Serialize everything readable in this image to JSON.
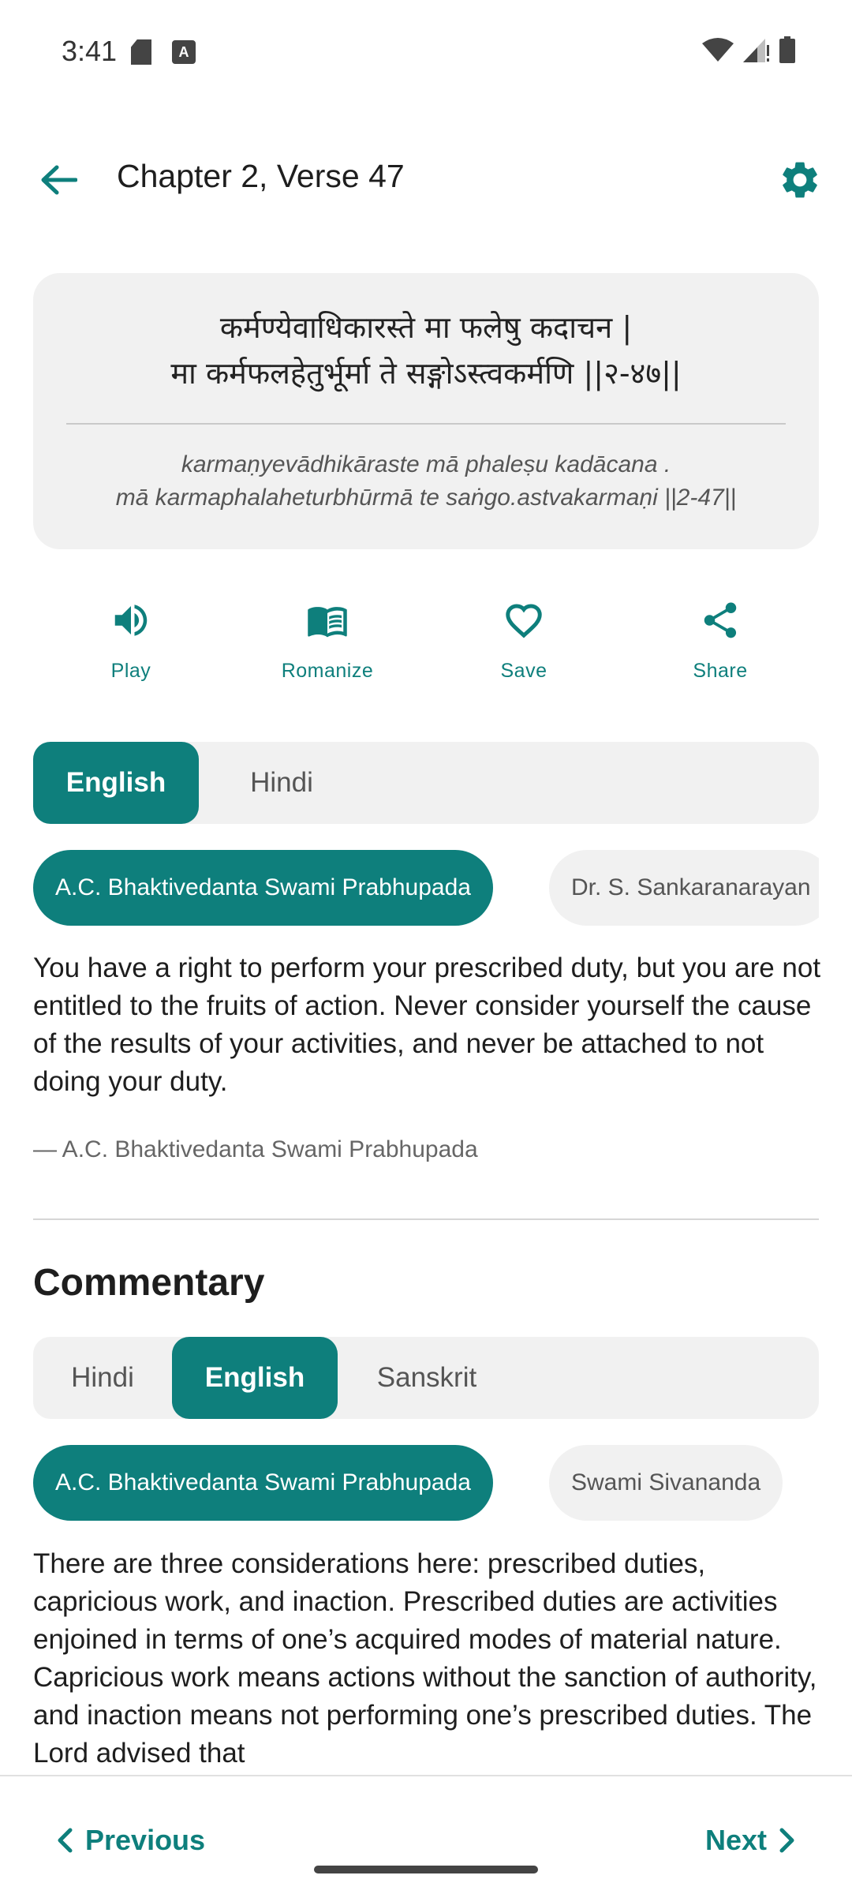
{
  "status_bar": {
    "time": "3:41"
  },
  "app_bar": {
    "title": "Chapter 2, Verse 47",
    "back_icon": "arrow-left-icon",
    "settings_icon": "gear-icon"
  },
  "verse": {
    "sanskrit_line1": "कर्मण्येवाधिकारस्ते मा फलेषु कदाचन |",
    "sanskrit_line2": "मा कर्मफलहेतुर्भूर्मा ते सङ्गोऽस्त्वकर्मणि ||२-४७||",
    "translit_line1": "karmaṇyevādhikāraste mā phaleṣu kadācana .",
    "translit_line2": "mā karmaphalaheturbhūrmā te saṅgo.astvakarmaṇi ||2-47||"
  },
  "actions": [
    {
      "label": "Play",
      "icon": "speaker-icon"
    },
    {
      "label": "Romanize",
      "icon": "book-open-icon"
    },
    {
      "label": "Save",
      "icon": "heart-icon"
    },
    {
      "label": "Share",
      "icon": "share-icon"
    }
  ],
  "translation_languages": {
    "selected": "English",
    "items": [
      "English",
      "Hindi"
    ]
  },
  "translation_authors": [
    "A.C. Bhaktivedanta Swami Prabhupada",
    "Dr. S. Sankaranarayan"
  ],
  "translation_text": "You have a right to perform your prescribed duty, but you are not entitled to the fruits of action. Never consider yourself the cause of the results of your activities, and never be attached to not doing your duty.",
  "translation_attribution": "— A.C. Bhaktivedanta Swami Prabhupada",
  "commentary": {
    "heading": "Commentary",
    "languages": [
      "Hindi",
      "English",
      "Sanskrit"
    ],
    "selected_language": "English",
    "authors": [
      "A.C. Bhaktivedanta Swami Prabhupada",
      "Swami Sivananda"
    ],
    "text": "There are three considerations here: prescribed duties, capricious work, and inaction. Prescribed duties are activities enjoined in terms of one’s acquired modes of material nature. Capricious work means actions without the sanction of authority, and inaction means not performing one’s prescribed duties. The Lord advised that"
  },
  "bottom_nav": {
    "previous": "Previous",
    "next": "Next"
  },
  "colors": {
    "accent": "#0e7f7c",
    "card": "#f1f1f1"
  }
}
